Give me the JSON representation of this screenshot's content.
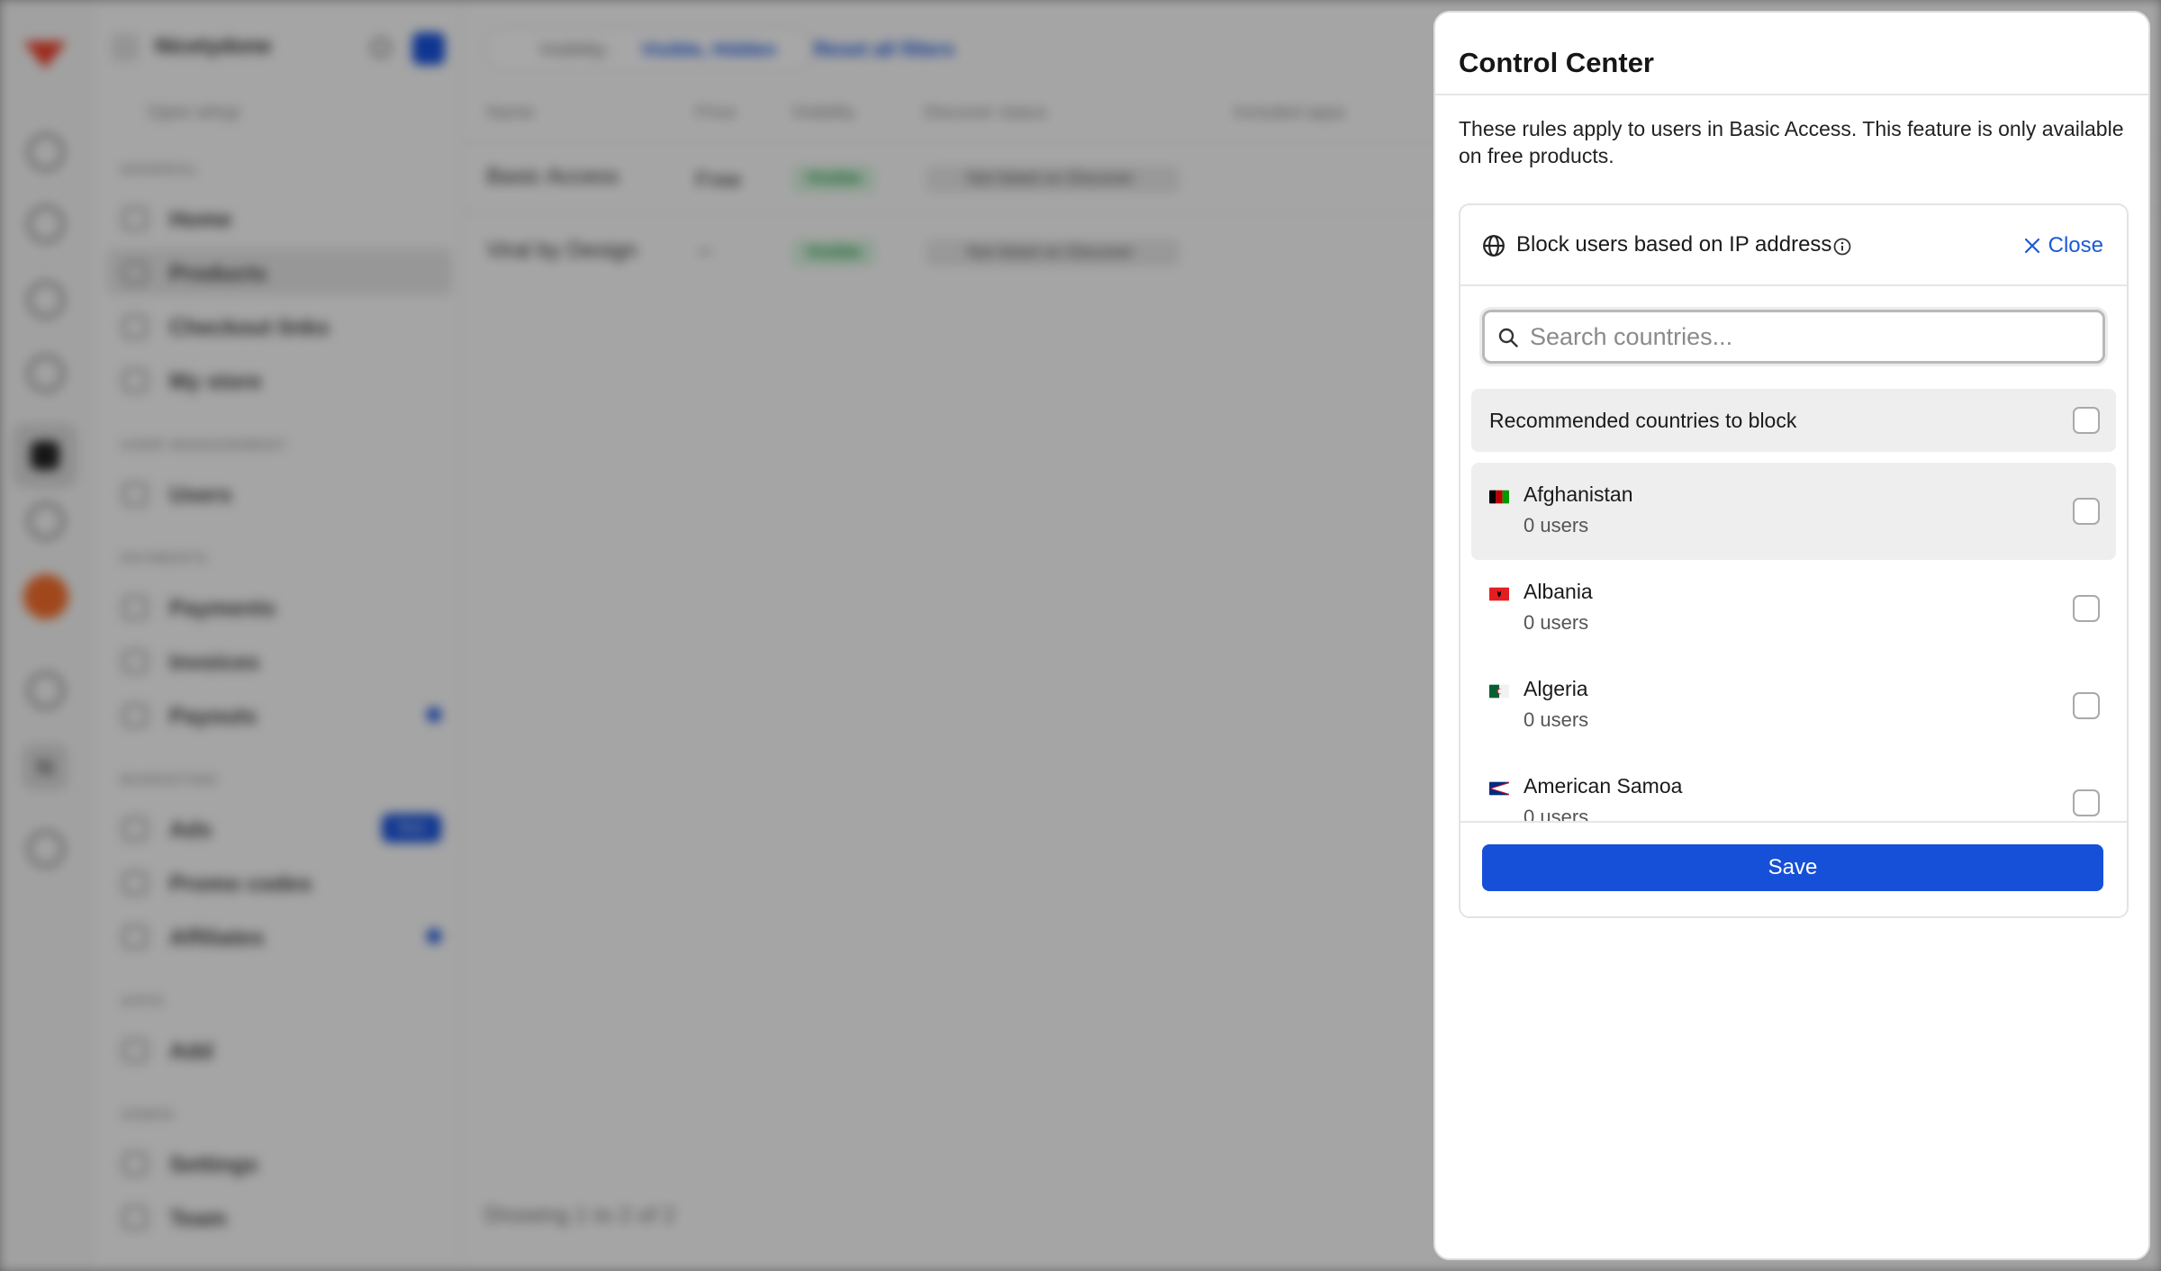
{
  "background": {
    "store_name": "Nicetydone",
    "open_whop": "Open whop",
    "sections": {
      "general": "GENERAL",
      "user_management": "USER MANAGEMENT",
      "payments": "PAYMENTS",
      "marketing": "MARKETING",
      "apps": "APPS",
      "admin": "ADMIN"
    },
    "nav": {
      "home": "Home",
      "products": "Products",
      "checkout_links": "Checkout links",
      "my_store": "My store",
      "users": "Users",
      "payments": "Payments",
      "invoices": "Invoices",
      "payouts": "Payouts",
      "ads": "Ads",
      "ads_badge": "New",
      "promo_codes": "Promo codes",
      "affiliates": "Affiliates",
      "add": "Add",
      "settings": "Settings",
      "team": "Team"
    },
    "rail_initial": "N",
    "filter": {
      "label": "Visibility ·",
      "value": "Visible, Hidden"
    },
    "reset_filters": "Reset all filters",
    "table": {
      "columns": [
        "Name",
        "Price",
        "Visibility",
        "Discover status",
        "Included apps"
      ],
      "rows": [
        {
          "name": "Basic Access",
          "price": "Free",
          "visibility": "Visible",
          "discover": "Not listed on Discover",
          "apps": "–"
        },
        {
          "name": "Viral by Design",
          "price": "–",
          "visibility": "Visible",
          "discover": "Not listed on Discover",
          "apps": "–"
        }
      ]
    },
    "pagination": "Showing 1 to 2 of 2"
  },
  "panel": {
    "title": "Control Center",
    "description": "These rules apply to users in Basic Access. This feature is only available on free products.",
    "card": {
      "heading": "Block users based on IP address",
      "close_label": "Close",
      "search_placeholder": "Search countries...",
      "recommended_label": "Recommended countries to block",
      "countries": [
        {
          "name": "Afghanistan",
          "users": "0 users",
          "highlighted": true,
          "flag_colors": [
            "#000000",
            "#be0000",
            "#009900"
          ]
        },
        {
          "name": "Albania",
          "users": "0 users",
          "highlighted": false,
          "flag_colors": [
            "#e41e20"
          ]
        },
        {
          "name": "Algeria",
          "users": "0 users",
          "highlighted": false,
          "flag_colors": [
            "#006233",
            "#ffffff",
            "#d21034"
          ]
        },
        {
          "name": "American Samoa",
          "users": "0 users",
          "highlighted": false,
          "flag_colors": [
            "#002b7f",
            "#ffffff",
            "#bf0a30"
          ]
        }
      ],
      "save_label": "Save"
    },
    "colors": {
      "accent": "#1650d8",
      "link": "#1a5ad6"
    }
  }
}
